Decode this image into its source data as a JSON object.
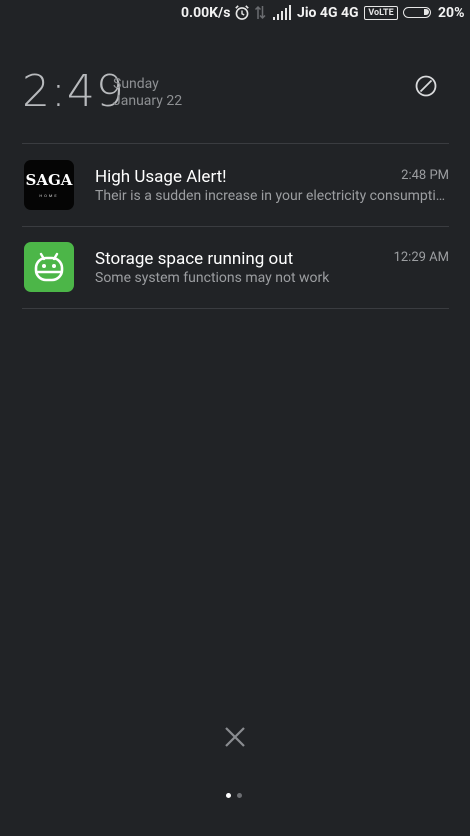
{
  "status_bar": {
    "network_speed": "0.00K/s",
    "carrier": "Jio 4G",
    "network_type": "4G",
    "volte": "VoLTE",
    "battery_percent": "20%",
    "battery_level": 0.2,
    "icons": [
      "alarm-icon",
      "data-arrows-icon",
      "signal-icon",
      "battery-icon"
    ]
  },
  "header": {
    "time": "2:49",
    "day": "Sunday",
    "date": "January 22",
    "dnd_icon": "do-not-disturb-icon"
  },
  "notifications": [
    {
      "app_icon": "saga-app-icon",
      "icon_text": "SAGA",
      "icon_subtext": "HOME",
      "title": "High Usage Alert!",
      "body": "Their is a sudden increase in your electricity consumption",
      "time": "2:48 PM"
    },
    {
      "app_icon": "android-system-icon",
      "title": "Storage space running out",
      "body": "Some system functions may not work",
      "time": "12:29 AM"
    }
  ],
  "footer": {
    "clear_icon": "close-icon",
    "page_count": 2,
    "active_page": 1
  },
  "colors": {
    "background": "#212326",
    "primary_text": "#ffffff",
    "secondary_text": "#9c9ea1",
    "android_green": "#4cb648"
  }
}
